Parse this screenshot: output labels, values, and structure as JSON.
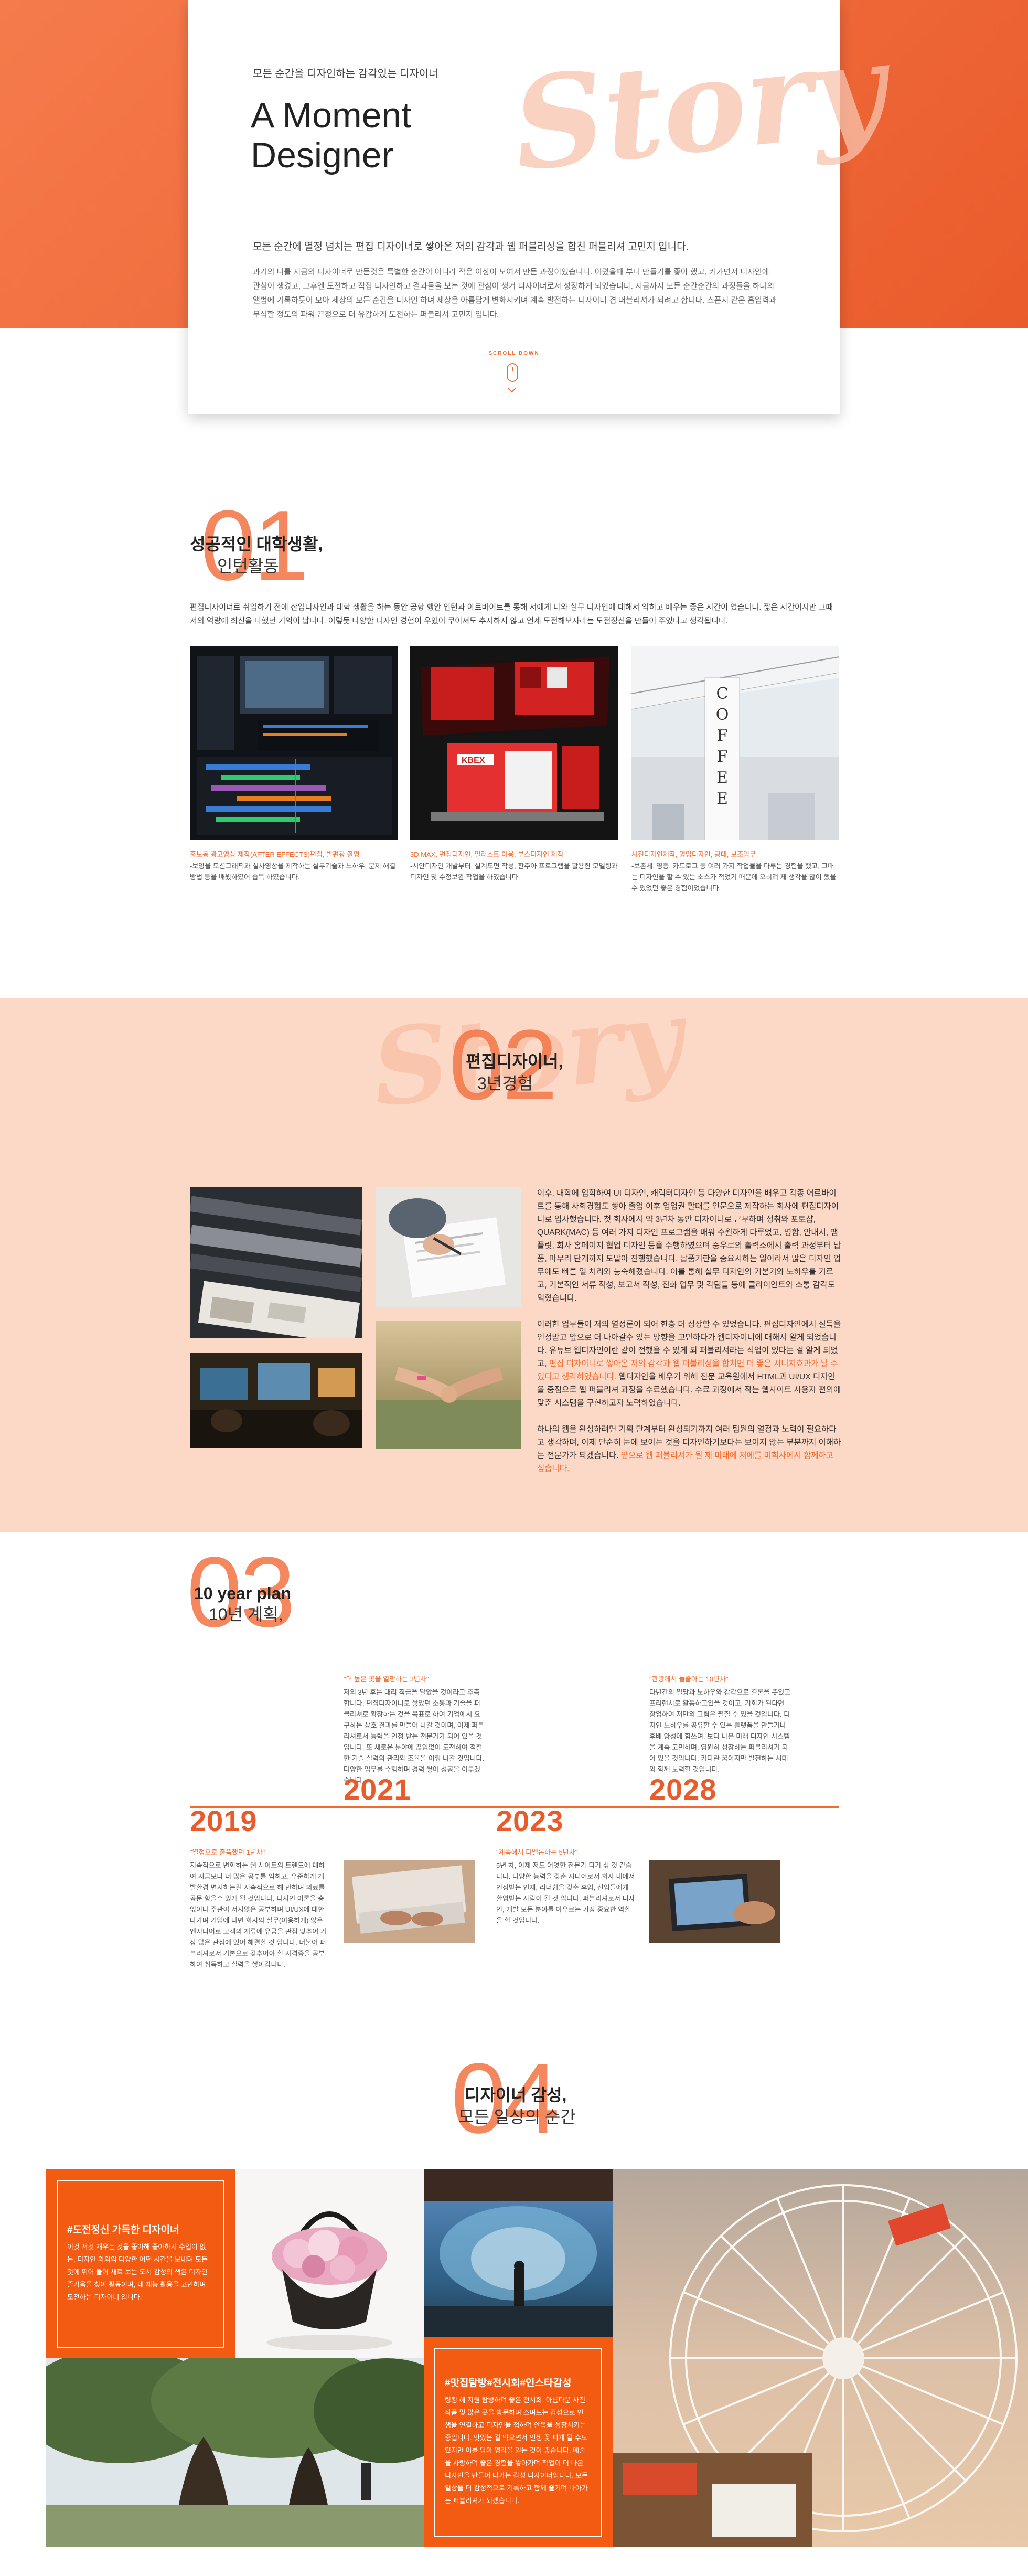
{
  "hero": {
    "kicker": "모든 순간을 디자인하는 감각있는 디자이너",
    "title_line1": "A Moment",
    "title_line2": "Designer",
    "bg_word": "Story",
    "lead": "모든 순간에 열정 넘치는 편집 디자이너로 쌓아온 저의 감각과 웹 퍼블리싱을 합친 퍼블리셔 고민지 입니다.",
    "body": "과거의 나를 지금의 디자이너로 만든것은 특별한 순간이 아니라 작은 이상이 모여서 만든 과정이었습니다. 어렸을때 부터 만들기를 좋아 했고, 커가면서 디자인에 관심이 생겼고, 그후엔 도전하고 직접 디자인하고 결과물을 보는 것에 관심이 생겨 디자이너로서 성장하게 되었습니다. 지금까지 모든 순간순간의 과정들을 하나의 앨범에 기록하듯이 모아 세상의 모든 순간을 디자인 하며 세상을 아름답게 변화시키며 계속 발전하는 디자이너 겸 퍼블리셔가 되려고 합니다. 스폰지 같은 흡입력과 무식할 정도의 파워 끈정으로 더 유감하게 도전하는 퍼블리셔 고민지 입니다.",
    "scroll_label": "SCROLL DOWN"
  },
  "section1": {
    "number": "01",
    "title": "성공적인 대학생활,",
    "subtitle": "인턴활동",
    "intro": "편집디자이너로 취업하기 전에 산업디자인과 대학 생활을 하는 동안 공항 행안 인턴과 아르바이트를 통해 저에게 나와 실무 디자인에 대해서 익히고 배우는 좋은 시간이 였습니다. 짧은 시간이지만 그때 저의 역량에 최선을 다했던 기억이 납니다. 이렇듯 다양한 디자인 경험이 우었이 쿠어져도 추지하지 않고 언제 도전해보자라는 도전정신을 만들어 주었다고 생각됩니다.",
    "captions": [
      {
        "title": "홍보동 광고영상 제작(AFTER EFFECTS)편집, 발편광 촬영",
        "body": "-보양을 모션그래픽과 실사영상을 제작하는 실무기술과 노하우, 문제 해결방법 등을 배웠하였어 습득 하였습니다."
      },
      {
        "title": "3D MAX, 편집디자인, 일러스트 이용, 부스디자인 제작",
        "body": "-시안디자인 개발부터, 설계도면 작성, 판주아 프로그램을 활용한 모델링과 디자인 및 수정보완 작업을 하였습니다."
      },
      {
        "title": "사진디자인제작, 영업디자인, 광대, 보조업무",
        "body": "-보존세, 영중, 카드로그 등 여러 가지 작업물을 다루는 경험을 했고, 그때는 디자인을 할 수 있는 소스가 적었기 때문에 오히려 제 생각을 많이 했을 수 있었던 좋은 경험이었습니다."
      }
    ],
    "coffee_sign": "COFFEE"
  },
  "section2": {
    "number": "02",
    "title": "편집디자이너,",
    "subtitle": "3년경험",
    "bg_word": "Story",
    "p1": "이후, 대학에 입학하여 UI 디자인, 캐릭터디자인 등 다양한 디자인을 배우고 각종 어르바이트를 통해 사회경험도 쌓아 졸업 이후 업업권 할때를 인문으로 제작하는 회사에 편집디자이너로 입사했습니다. 첫 회사에서 약 3년차 동안 디자이너로 근무하며 성취와 포토샵, QUARK(MAC) 등 여러 가지 디자인 프로그램을 배워 수월하게 다루었고, 명함, 안내서, 팸플릿, 회사 홍페이지 협업 디자인 등을 수행하였으며 중우로의 출력소에서 출력 과정부터 납품, 마무리 단계까지 도맡아 진행했습니다. 납품기한을 중요시하는 일이라서 많은 디자인 업무에도 빠른 일 처리와 능숙해졌습니다. 이를 통해 실무 디자인의 기본기와 노하우를 기르고, 기본적인 서류 작성, 보고서 작성, 전화 업무 및 각팀들 등에 클라이언트와 소통 감각도 익혔습니다.",
    "p2_a": "이러한 업무들이 저의 열정론이 되어 한층 더 성장할 수 있었습니다. 편집디자인에서 설득을 인정받고 앞으로 더 나아갈수 있는 방향을 고민하다가 웹디자이너에 대해서 알게 되었습니다. 유튜브 웹디자인이란 같이 전했을 수 있게 되 퍼블리셔라는 직업이 있다는 걸 알게 되었고,",
    "p2_highlight": "편집 디자이너로 쌓아온 저의 감각과 웹 퍼블리싱을 합치면 더 좋은 시너지효과가 날 수 있다고 생각하였습니다.",
    "p2_b": "웹디자인을 배우기 위해 전문 교육원에서 HTML과 UI/UX 디자인을 중점으로 웹 퍼블리셔 과정을 수료했습니다. 수료 과정에서 작는 웹사이트 사용자 편의에 맞춘 시스템을 구현하고자 노력하였습니다.",
    "p3_a": "하나의 웹을 완성하려면 기획 단계부터 완성되기까지 여러 팀원의 열정과 노력이 필요하다고 생각하며, 이제 단순히 눈에 보이는 것을 디자인하기보다는 보이지 않는 부분까지 이해하는 전문가가 되겠습니다.",
    "p3_highlight": "앞으로 웹 퍼블리셔가 될 제 미래에 저에를 미희사에서 함께하고 싶습니다."
  },
  "section3": {
    "number": "03",
    "title": "10 year plan",
    "subtitle": "10년 계획,",
    "years": [
      "2019",
      "2021",
      "2023",
      "2028"
    ],
    "items": [
      {
        "quote": "\"열정으로 출품했던 1년차\"",
        "body": "지속적으로 변화하는 웹 사이트의 트렌드에 대하여 지금보다 더 많은 공부를 익히고, 우준하게 개발환경 변지하는걸 지속적으로 해 만하며 의료를 공문 항을수 있게 될 것입니다. 디자인 이론을 충없이다 주관이 서지않은 공부하며 UI/UX에 대한 나가며 기업에 다면 회사의 실무(이용하게) 않은 엔지니어로 고객의 개류에 유궁을 관점 맞추어 가장 많은 관심에 있어 해결할 것 입니다. 더불어 퍼블리셔로서 기본으로 갖추어야 할 자격증을 공부하여 취득하고 실력을 쌓아갑니다."
      },
      {
        "quote": "\"더 높은 곳을 열망하는 3년차\"",
        "body": "저의 3년 후는 대리 직급을 달았을 것이라고 추측합니다. 편집디자이너로 쌓았던 소통과 기술을 퍼블리셔로 확장하는 것을 목표로 하여 기업에서 요구하는 상호 결과를 만들어 나갈 것이며, 이제 퍼블리셔로서 능력을 인정 받는 전문가가 되어 있을 것입니다. 또 새로운 분야에 끊임없이 도전하여 적절한 기술 실력의 관리와 조율을 이뤄 나갈 것입니다. 다양한 업무를 수행하며 경력 쌓아 성공을 이루겠습니다."
      },
      {
        "quote": "\"계속해서 디벨롭하는 5년차\"",
        "body": "5년 차, 이제 저도 어엿한 전문가 되기 싶 것 같습니다. 다양한 능력을 갖춘 시니어로서 회사 내에서 인정받는 인재, 리더쉽을 갖춘 후임, 선임들에게 환영받는 사람이 될 것 입니다. 퍼블리셔로서 디자인, 개발 모든 분야를 아우르는 가장 중요한 역할을 할 것입니다."
      },
      {
        "quote": "\"관광에서 놀줄아는 10년차\"",
        "body": "다년간의 밀망과 노하우와 감각으로 결론을 뜻있고 프리랜서로 활동하고있을 것이고, 기회가 된다면 창업하여 저만의 그림은 펼칠 수 있을 것입니다. 디자인 노하우를 공유할 수 있는 플랫폼을 만들거나 후배 양성에 힘쓰며, 보다 나은 미래 디자인 시스템을 계속 고민하며, 영원히 성장하는 퍼블리셔가 되어 있을 것입니다. 커다란 꿈이지만 발전하는 시대와 함께 노력할 것입니다."
      }
    ]
  },
  "section4": {
    "number": "04",
    "title": "디자이너 감성,",
    "subtitle": "모든 일상의 순간",
    "tag1": {
      "title": "#도전정신 가득한 디자이너",
      "body": "이것 저것 재우는 것을 좋아해 좋아하지 수업이 없는, 디자인 의외의 다양한 어떤 시간을 보내며 모든 것에 뛰어 들어 새로 보는 도시 감성의 색은 디자인 즐거움을 찾아 활동이며, 내 재능 활용을 고민하며 도전하는 디자이너 입니다."
    },
    "tag2": {
      "title": "#맛집탐방#전시회#인스타감성",
      "body": "링킹 해 지원 탐방하며 좋은 전시회, 아름다운 사진 작품 및 많은 곳을 방문하며 스며드는 감성으로 인생을 연결하고 디자인을 접하며 안목을 성장시키는 중입니다. 맛있는 걸 먹으면서 인생 꽃 피게 될 수도 있지만 이를 담아 영감을 얻는 것이 좋습니다. 예술을 사랑하며 좋은 경험을 쌓아가며 작업이 더 나은 디자인을 만들어 나가는 감성 디자이너입니다. 모든 일상을 더 감성적으로 기록하고 함께 즐기며 나아가는 퍼블리셔가 되겠습니다."
    }
  },
  "colors": {
    "accent": "#f36a2e",
    "accent_dark": "#ea5b2b",
    "peach_band": "#fcd8c6",
    "tag_box": "#f35b12"
  }
}
